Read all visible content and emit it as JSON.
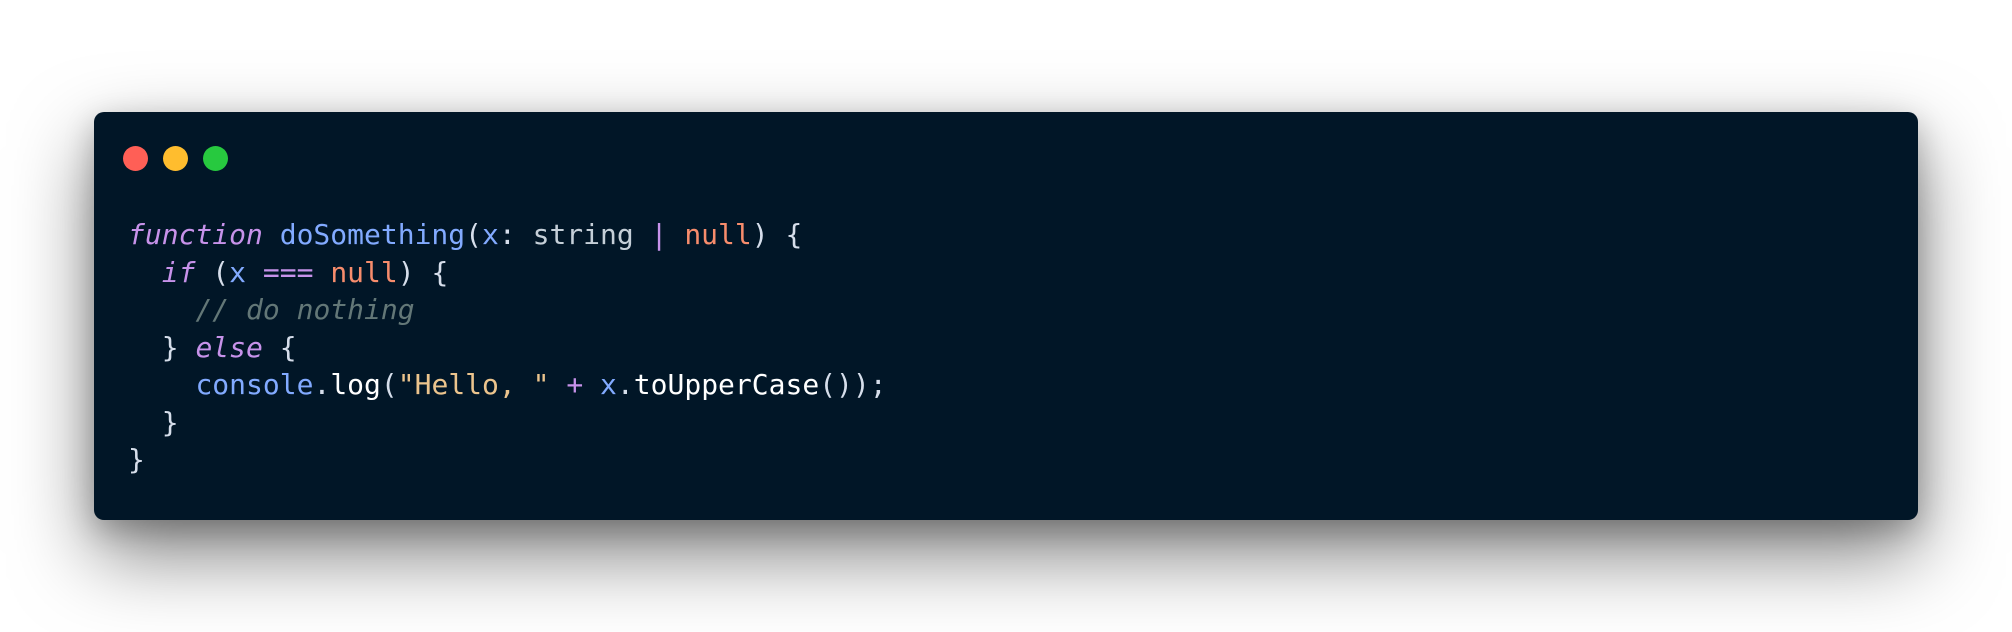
{
  "window": {
    "controls": [
      {
        "name": "close-button",
        "color": "#ff5f56"
      },
      {
        "name": "minimize-button",
        "color": "#ffbd2e"
      },
      {
        "name": "maximize-button",
        "color": "#27c93f"
      }
    ]
  },
  "code": {
    "lines": [
      [
        {
          "t": "function",
          "c": "kw-it"
        },
        {
          "t": " ",
          "c": "plain"
        },
        {
          "t": "doSomething",
          "c": "fn"
        },
        {
          "t": "(",
          "c": "punc"
        },
        {
          "t": "x",
          "c": "var"
        },
        {
          "t": ": ",
          "c": "punc"
        },
        {
          "t": "string",
          "c": "type"
        },
        {
          "t": " ",
          "c": "plain"
        },
        {
          "t": "|",
          "c": "op"
        },
        {
          "t": " ",
          "c": "plain"
        },
        {
          "t": "null",
          "c": "null"
        },
        {
          "t": ") {",
          "c": "punc"
        }
      ],
      [
        {
          "t": "  ",
          "c": "plain"
        },
        {
          "t": "if",
          "c": "kw-it"
        },
        {
          "t": " (",
          "c": "punc"
        },
        {
          "t": "x",
          "c": "var"
        },
        {
          "t": " ",
          "c": "plain"
        },
        {
          "t": "===",
          "c": "op"
        },
        {
          "t": " ",
          "c": "plain"
        },
        {
          "t": "null",
          "c": "null"
        },
        {
          "t": ") {",
          "c": "punc"
        }
      ],
      [
        {
          "t": "    ",
          "c": "plain"
        },
        {
          "t": "// do nothing",
          "c": "comment"
        }
      ],
      [
        {
          "t": "  } ",
          "c": "punc"
        },
        {
          "t": "else",
          "c": "kw-it"
        },
        {
          "t": " {",
          "c": "punc"
        }
      ],
      [
        {
          "t": "    ",
          "c": "plain"
        },
        {
          "t": "console",
          "c": "var"
        },
        {
          "t": ".",
          "c": "punc"
        },
        {
          "t": "log",
          "c": "method"
        },
        {
          "t": "(",
          "c": "punc"
        },
        {
          "t": "\"Hello, \"",
          "c": "str"
        },
        {
          "t": " ",
          "c": "plain"
        },
        {
          "t": "+",
          "c": "op"
        },
        {
          "t": " ",
          "c": "plain"
        },
        {
          "t": "x",
          "c": "var"
        },
        {
          "t": ".",
          "c": "punc"
        },
        {
          "t": "toUpperCase",
          "c": "method"
        },
        {
          "t": "());",
          "c": "punc"
        }
      ],
      [
        {
          "t": "  }",
          "c": "punc"
        }
      ],
      [
        {
          "t": "}",
          "c": "punc"
        }
      ]
    ]
  }
}
